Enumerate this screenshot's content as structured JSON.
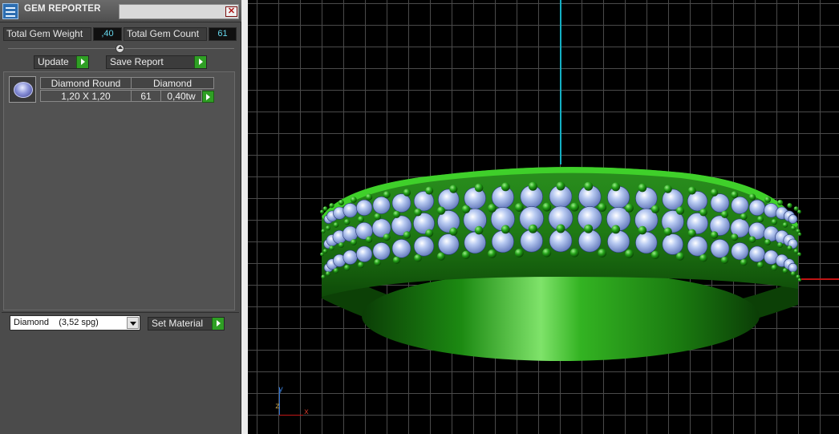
{
  "panel": {
    "title": "GEM REPORTER",
    "close_glyph": "✕",
    "app_icon": "gem-reporter-app-icon",
    "total_weight_label": "Total Gem Weight",
    "total_weight_value": ",40",
    "total_count_label": "Total Gem Count",
    "total_count_value": "61",
    "update_label": "Update",
    "save_report_label": "Save Report",
    "gem_table": {
      "headers": [
        "Diamond Round",
        "Diamond"
      ],
      "rows": [
        {
          "size": "1,20 X 1,20",
          "count": "61",
          "weight": "0,40tw",
          "thumbnail": "round-gem-thumbnail"
        }
      ]
    },
    "material_select": {
      "selected": "Diamond    (3,52 spg)"
    },
    "set_material_label": "Set Material",
    "colors": {
      "panel_bg": "#4b4b4b",
      "action_green": "#2f9f24",
      "value_cyan": "#66d8ee"
    }
  },
  "viewport": {
    "axis_y_color": "#13b0c4",
    "axis_x_color": "#c01414",
    "gizmo": {
      "y": "y",
      "z": "z",
      "x": "x"
    },
    "model": "green-ring-with-pave-diamonds"
  }
}
